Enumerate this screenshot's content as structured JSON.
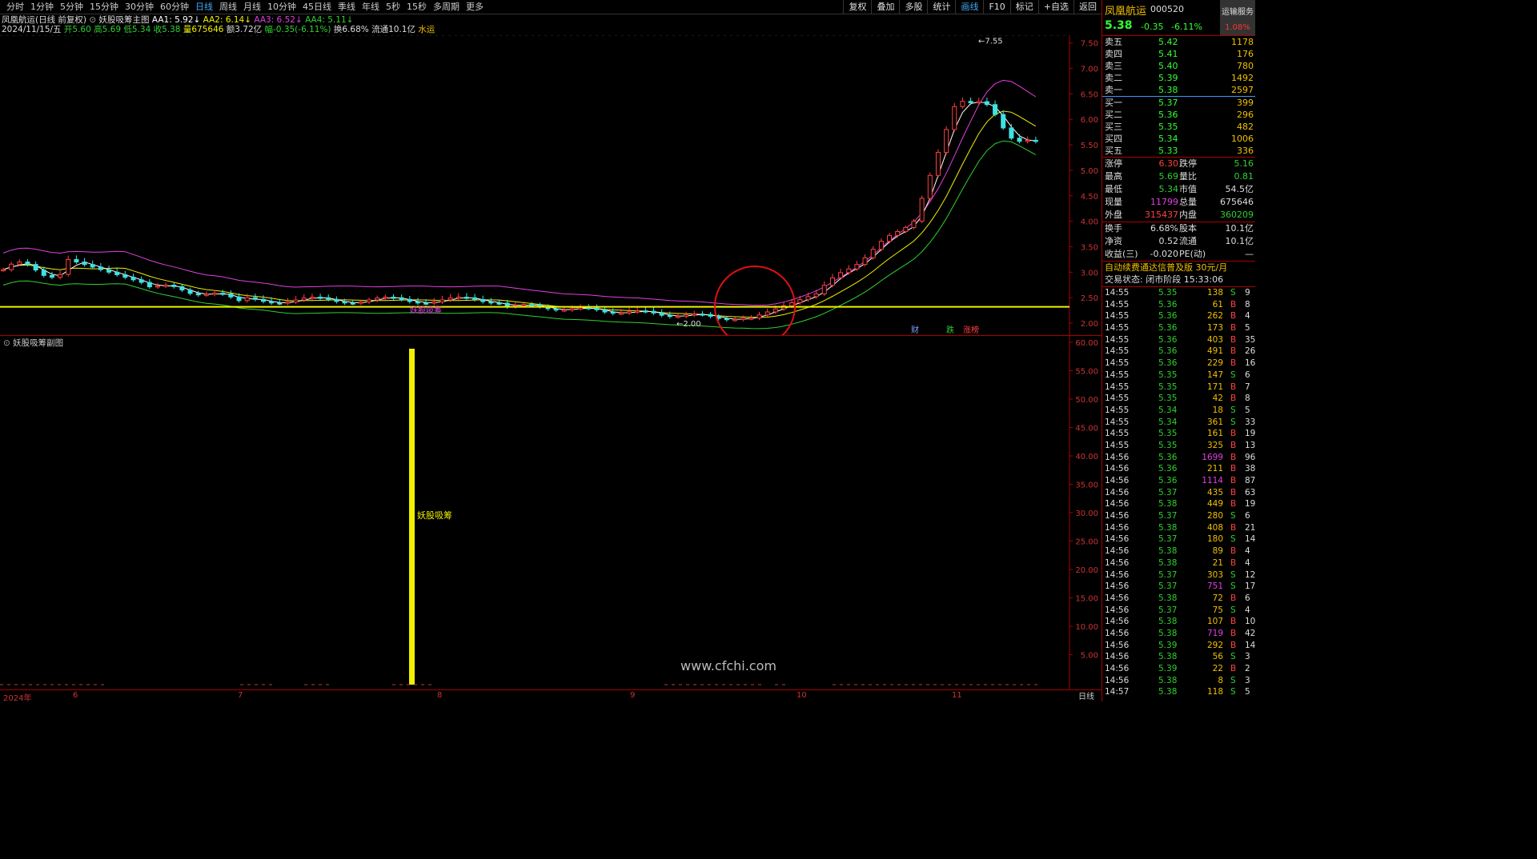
{
  "periods": [
    "分时",
    "1分钟",
    "5分钟",
    "15分钟",
    "30分钟",
    "60分钟",
    "日线",
    "周线",
    "月线",
    "10分钟",
    "45日线",
    "季线",
    "年线",
    "5秒",
    "15秒",
    "多周期",
    "更多"
  ],
  "active_period": "日线",
  "toolbar": [
    "复权",
    "叠加",
    "多股",
    "统计",
    "画线",
    "F10",
    "标记",
    "+自选",
    "返回"
  ],
  "active_tool": "画线",
  "stock_title": "凤凰航运(日线 前复权)",
  "indicator_name": "妖股吸筹主图",
  "aa": [
    {
      "label": "AA1: 5.92",
      "color": "#ffffff"
    },
    {
      "label": "AA2: 6.14",
      "color": "#f0f000"
    },
    {
      "label": "AA3: 6.52",
      "color": "#e040e0"
    },
    {
      "label": "AA4: 5.11",
      "color": "#30d030"
    }
  ],
  "bar_info": {
    "date": "2024/11/15/五",
    "open": "开5.60",
    "high": "高5.69",
    "low": "低5.34",
    "close": "收5.38",
    "volume": "量675646",
    "amount": "额3.72亿",
    "change": "幅-0.35(-6.11%)",
    "turnover": "换6.68%",
    "float": "流通10.1亿",
    "sector": "水运"
  },
  "main_y_ticks": [
    "7.50",
    "7.00",
    "6.50",
    "6.00",
    "5.50",
    "5.00",
    "4.50",
    "4.00",
    "3.50",
    "3.00",
    "2.50",
    "2.00"
  ],
  "sub_y_ticks": [
    "60.00",
    "55.00",
    "50.00",
    "45.00",
    "40.00",
    "35.00",
    "30.00",
    "25.00",
    "20.00",
    "15.00",
    "10.00",
    "5.00"
  ],
  "annotations": {
    "high": "7.55",
    "low": "2.00",
    "suck_label": "妖股吸筹",
    "bottom_labels": [
      "财",
      "跌",
      "涨榜"
    ]
  },
  "sub_title": "妖股吸筹副图",
  "date_axis": [
    "2024年",
    "6",
    "7",
    "8",
    "9",
    "10",
    "11"
  ],
  "period_label": "日线",
  "watermark": "www.cfchi.com",
  "right": {
    "name": "凤凰航运",
    "code": "000520",
    "service": "运输服务",
    "service_pct": "1.08%",
    "price": "5.38",
    "change": "-0.35",
    "change_pct": "-6.11%",
    "asks": [
      {
        "label": "卖五",
        "price": "5.42",
        "vol": "1178"
      },
      {
        "label": "卖四",
        "price": "5.41",
        "vol": "176"
      },
      {
        "label": "卖三",
        "price": "5.40",
        "vol": "780"
      },
      {
        "label": "卖二",
        "price": "5.39",
        "vol": "1492"
      },
      {
        "label": "卖一",
        "price": "5.38",
        "vol": "2597"
      }
    ],
    "bids": [
      {
        "label": "买一",
        "price": "5.37",
        "vol": "399"
      },
      {
        "label": "买二",
        "price": "5.36",
        "vol": "296"
      },
      {
        "label": "买三",
        "price": "5.35",
        "vol": "482"
      },
      {
        "label": "买四",
        "price": "5.34",
        "vol": "1006"
      },
      {
        "label": "买五",
        "price": "5.33",
        "vol": "336"
      }
    ],
    "stats": [
      {
        "l1": "涨停",
        "v1": "6.30",
        "c1": "#ff4040",
        "l2": "跌停",
        "v2": "5.16",
        "c2": "#30d030"
      },
      {
        "l1": "最高",
        "v1": "5.69",
        "c1": "#30d030",
        "l2": "量比",
        "v2": "0.81",
        "c2": "#30d030"
      },
      {
        "l1": "最低",
        "v1": "5.34",
        "c1": "#30d030",
        "l2": "市值",
        "v2": "54.5亿",
        "c2": "#dddddd"
      },
      {
        "l1": "现量",
        "v1": "11799",
        "c1": "#e040e0",
        "l2": "总量",
        "v2": "675646",
        "c2": "#dddddd"
      },
      {
        "l1": "外盘",
        "v1": "315437",
        "c1": "#ff4040",
        "l2": "内盘",
        "v2": "360209",
        "c2": "#30d030"
      }
    ],
    "stats2": [
      {
        "l1": "换手",
        "v1": "6.68%",
        "c1": "#dddddd",
        "l2": "股本",
        "v2": "10.1亿",
        "c2": "#dddddd"
      },
      {
        "l1": "净资",
        "v1": "0.52",
        "c1": "#dddddd",
        "l2": "流通",
        "v2": "10.1亿",
        "c2": "#dddddd"
      },
      {
        "l1": "收益(三)",
        "v1": "-0.020",
        "c1": "#dddddd",
        "l2": "PE(动)",
        "v2": "—",
        "c2": "#dddddd"
      }
    ],
    "ad": "自动续费通达信普及版  30元/月",
    "phase": "交易状态: 闭市阶段 15:33:06",
    "ticks": [
      [
        "14:55",
        "5.35",
        "138",
        "S",
        "9"
      ],
      [
        "14:55",
        "5.36",
        "61",
        "B",
        "8"
      ],
      [
        "14:55",
        "5.36",
        "262",
        "B",
        "4"
      ],
      [
        "14:55",
        "5.36",
        "173",
        "B",
        "5"
      ],
      [
        "14:55",
        "5.36",
        "403",
        "B",
        "35"
      ],
      [
        "14:55",
        "5.36",
        "491",
        "B",
        "26"
      ],
      [
        "14:55",
        "5.36",
        "229",
        "B",
        "16"
      ],
      [
        "14:55",
        "5.35",
        "147",
        "S",
        "6"
      ],
      [
        "14:55",
        "5.35",
        "171",
        "B",
        "7"
      ],
      [
        "14:55",
        "5.35",
        "42",
        "B",
        "8"
      ],
      [
        "14:55",
        "5.34",
        "18",
        "S",
        "5"
      ],
      [
        "14:55",
        "5.34",
        "361",
        "S",
        "33"
      ],
      [
        "14:55",
        "5.35",
        "161",
        "B",
        "19"
      ],
      [
        "14:55",
        "5.35",
        "325",
        "B",
        "13"
      ],
      [
        "14:56",
        "5.36",
        "1699",
        "B",
        "96"
      ],
      [
        "14:56",
        "5.36",
        "211",
        "B",
        "38"
      ],
      [
        "14:56",
        "5.36",
        "1114",
        "B",
        "87"
      ],
      [
        "14:56",
        "5.37",
        "435",
        "B",
        "63"
      ],
      [
        "14:56",
        "5.38",
        "449",
        "B",
        "19"
      ],
      [
        "14:56",
        "5.37",
        "280",
        "S",
        "6"
      ],
      [
        "14:56",
        "5.38",
        "408",
        "B",
        "21"
      ],
      [
        "14:56",
        "5.37",
        "180",
        "S",
        "14"
      ],
      [
        "14:56",
        "5.38",
        "89",
        "B",
        "4"
      ],
      [
        "14:56",
        "5.38",
        "21",
        "B",
        "4"
      ],
      [
        "14:56",
        "5.37",
        "303",
        "S",
        "12"
      ],
      [
        "14:56",
        "5.37",
        "751",
        "S",
        "17"
      ],
      [
        "14:56",
        "5.38",
        "72",
        "B",
        "6"
      ],
      [
        "14:56",
        "5.37",
        "75",
        "S",
        "4"
      ],
      [
        "14:56",
        "5.38",
        "107",
        "B",
        "10"
      ],
      [
        "14:56",
        "5.38",
        "719",
        "B",
        "42"
      ],
      [
        "14:56",
        "5.39",
        "292",
        "B",
        "14"
      ],
      [
        "14:56",
        "5.38",
        "56",
        "S",
        "3"
      ],
      [
        "14:56",
        "5.39",
        "22",
        "B",
        "2"
      ],
      [
        "14:56",
        "5.38",
        "8",
        "S",
        "3"
      ],
      [
        "14:57",
        "5.38",
        "118",
        "S",
        "5"
      ]
    ]
  },
  "colors": {
    "up": "#ff4040",
    "down": "#30d030",
    "yellow": "#f0f000",
    "magenta": "#e040e0",
    "cyan": "#40e0e0",
    "axis": "#aa0000"
  }
}
